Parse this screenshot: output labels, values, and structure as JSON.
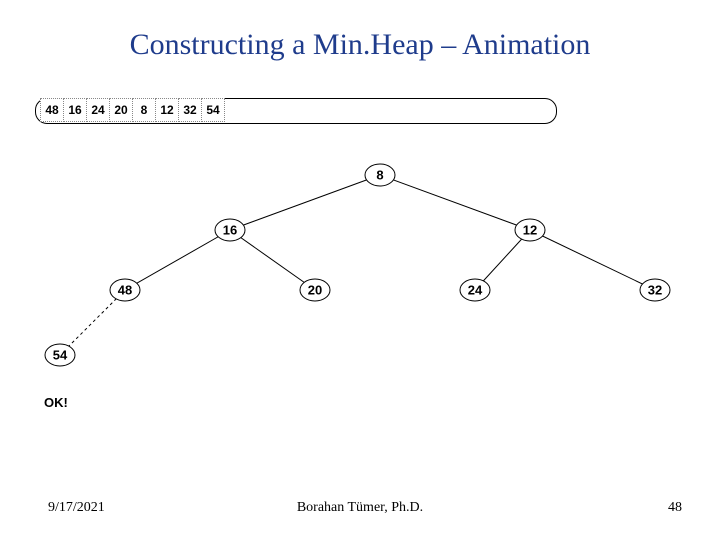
{
  "title": "Constructing a Min.Heap – Animation",
  "array": [
    "48",
    "16",
    "24",
    "20",
    "8",
    "12",
    "32",
    "54"
  ],
  "tree": {
    "n1": "8",
    "n2": "16",
    "n3": "12",
    "n4": "48",
    "n5": "20",
    "n6": "24",
    "n7": "32",
    "n8": "54"
  },
  "status": "OK!",
  "footer": {
    "date": "9/17/2021",
    "author": "Borahan Tümer, Ph.D.",
    "page": "48"
  }
}
